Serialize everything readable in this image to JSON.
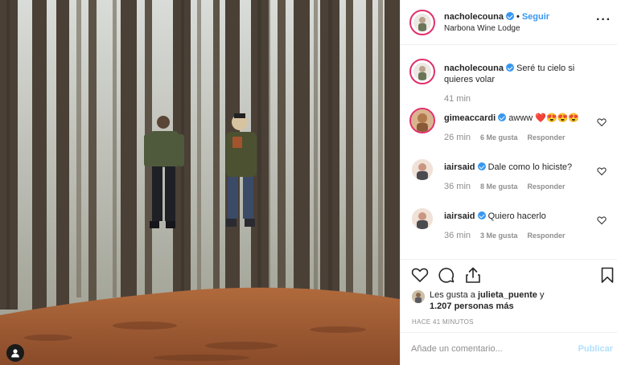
{
  "post": {
    "username": "nacholecouna",
    "follow_label": "Seguir",
    "separator": "•",
    "location": "Narbona Wine Lodge",
    "more_label": "···"
  },
  "caption": {
    "username": "nacholecouna",
    "text": "Seré tu cielo si quieres volar",
    "time": "41 min"
  },
  "comments": [
    {
      "username": "gimeaccardi",
      "text": "awww ❤️😍😍😍",
      "time": "26 min",
      "likes": "6 Me gusta",
      "reply": "Responder"
    },
    {
      "username": "iairsaid",
      "text": "Dale como lo hiciste?",
      "time": "36 min",
      "likes": "8 Me gusta",
      "reply": "Responder"
    },
    {
      "username": "iairsaid",
      "text": "Quiero hacerlo",
      "time": "36 min",
      "likes": "3 Me gusta",
      "reply": "Responder"
    }
  ],
  "likes_summary": {
    "prefix": "Les gusta a",
    "user": "julieta_puente",
    "conj": "y",
    "count": "1.207 personas más"
  },
  "time_ago": "HACE 41 MINUTOS",
  "add_comment": {
    "placeholder": "Añade un comentario...",
    "publish_label": "Publicar"
  },
  "colors": {
    "accent": "#3897f0",
    "story_ring": "#e1306c",
    "muted": "#8e8e8e"
  },
  "icons": [
    "heart-icon",
    "comment-icon",
    "share-icon",
    "bookmark-icon",
    "user-tag-icon",
    "verified-icon",
    "more-icon"
  ]
}
